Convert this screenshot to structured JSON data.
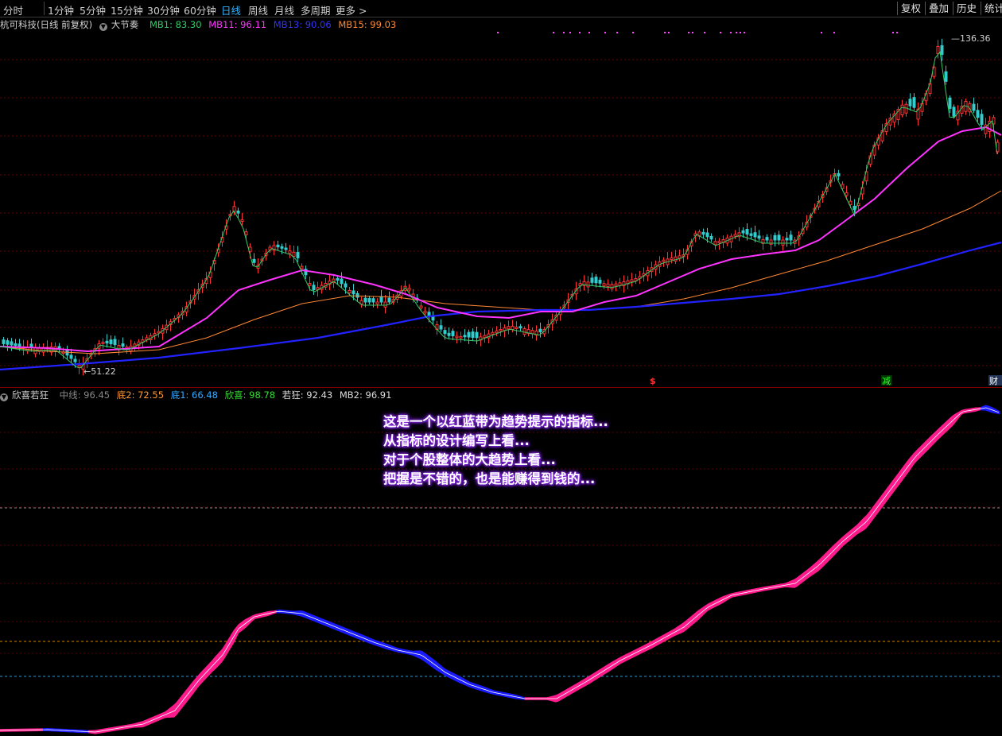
{
  "toolbar": {
    "periods": [
      "分时",
      "1分钟",
      "5分钟",
      "15分钟",
      "30分钟",
      "60分钟",
      "日线",
      "周线",
      "月线",
      "多周期",
      "更多"
    ],
    "active_period": "日线",
    "buttons": [
      "复权",
      "叠加",
      "历史",
      "统计"
    ]
  },
  "upper_panel": {
    "title": "杭可科技(日线 前复权)",
    "indicator": "大节奏",
    "mb1": "MB1: 83.30",
    "mb11": "MB11: 96.11",
    "mb13": "MB13: 90.06",
    "mb15": "MB15: 99.03",
    "high_label": "136.36",
    "low_label": "51.22",
    "marker_dollar": "$",
    "marker_reduce": "减",
    "marker_finance": "财",
    "colors": {
      "mb1": "#33cc66",
      "mb11": "#ff33ff",
      "mb13": "#2222ff",
      "mb15": "#ff8833",
      "up": "#ff3333",
      "down": "#33cccc"
    }
  },
  "lower_panel": {
    "title": "欣喜若狂",
    "mid": "中线: 96.45",
    "bottom2": "底2: 72.55",
    "bottom1": "底1: 66.48",
    "xinxi": "欣喜: 98.78",
    "ruokuang": "若狂: 92.43",
    "mb2": "MB2: 96.91",
    "colors": {
      "mid": "#888888",
      "bottom2": "#ff9933",
      "bottom1": "#33aaff",
      "xinxi": "#33dd33",
      "ruokuang": "#dddddd",
      "mb2": "#dddddd",
      "band_up": "#ff1a8c",
      "band_down": "#1a1aff"
    }
  },
  "annotation": {
    "lines": [
      "这是一个以红蓝带为趋势提示的指标...",
      "从指标的设计编写上看...",
      "对于个股整体的大趋势上看...",
      "把握是不错的，也是能赚得到钱的..."
    ]
  }
}
